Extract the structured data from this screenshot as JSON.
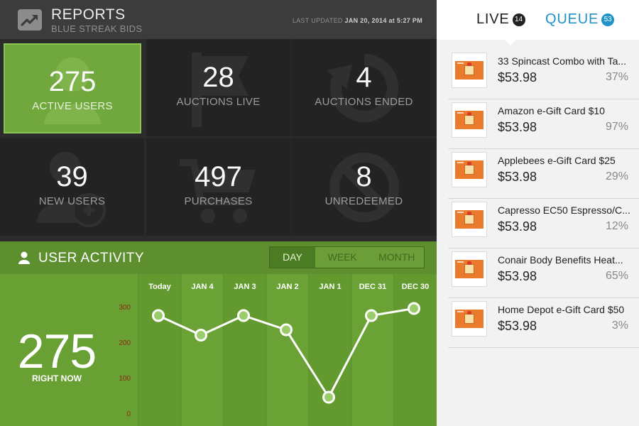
{
  "header": {
    "title": "REPORTS",
    "subtitle": "BLUE STREAK BIDS",
    "updated_prefix": "LAST UPDATED ",
    "updated_value": "JAN 20, 2014 at 5:27 PM",
    "logo_icon": "trending-up-icon"
  },
  "tiles": [
    {
      "value": "275",
      "label": "ACTIVE USERS",
      "icon": "user-icon",
      "active": true
    },
    {
      "value": "28",
      "label": "AUCTIONS LIVE",
      "icon": "flag-icon",
      "active": false
    },
    {
      "value": "4",
      "label": "AUCTIONS ENDED",
      "icon": "refresh-icon",
      "active": false
    },
    {
      "value": "39",
      "label": "NEW USERS",
      "icon": "add-user-icon",
      "active": false
    },
    {
      "value": "497",
      "label": "PURCHASES",
      "icon": "cart-icon",
      "active": false
    },
    {
      "value": "8",
      "label": "UNREDEEMED",
      "icon": "prohibited-icon",
      "active": false
    }
  ],
  "activity": {
    "title": "USER ACTIVITY",
    "icon": "user-icon",
    "periods": [
      "DAY",
      "WEEK",
      "MONTH"
    ],
    "selected_period": "DAY",
    "now_value": "275",
    "now_label": "RIGHT NOW"
  },
  "chart_data": {
    "type": "line",
    "categories": [
      "Today",
      "JAN 4",
      "JAN 3",
      "JAN 2",
      "JAN 1",
      "DEC 31",
      "DEC 30"
    ],
    "series": [
      {
        "values": [
          275,
          220,
          275,
          235,
          45,
          275,
          295
        ]
      }
    ],
    "yticks": [
      300,
      200,
      100,
      0
    ],
    "ylim": [
      0,
      300
    ],
    "grid": false
  },
  "colors": {
    "accent_green": "#71a83e",
    "chart_panel": "#68a034",
    "queue_blue": "#1f93c9",
    "tick_red": "#8a2b10"
  },
  "tabs": {
    "live": {
      "label": "LIVE",
      "count": "14"
    },
    "queue": {
      "label": "QUEUE",
      "count": "53"
    }
  },
  "items": [
    {
      "name": "33 Spincast Combo with Ta...",
      "price": "$53.98",
      "pct": "37%"
    },
    {
      "name": "Amazon e-Gift Card $10",
      "price": "$53.98",
      "pct": "97%"
    },
    {
      "name": "Applebees e-Gift Card $25",
      "price": "$53.98",
      "pct": "29%"
    },
    {
      "name": "Capresso EC50 Espresso/C...",
      "price": "$53.98",
      "pct": "12%"
    },
    {
      "name": "Conair Body Benefits Heat...",
      "price": "$53.98",
      "pct": "65%"
    },
    {
      "name": "Home Depot e-Gift Card $50",
      "price": "$53.98",
      "pct": "3%"
    }
  ]
}
